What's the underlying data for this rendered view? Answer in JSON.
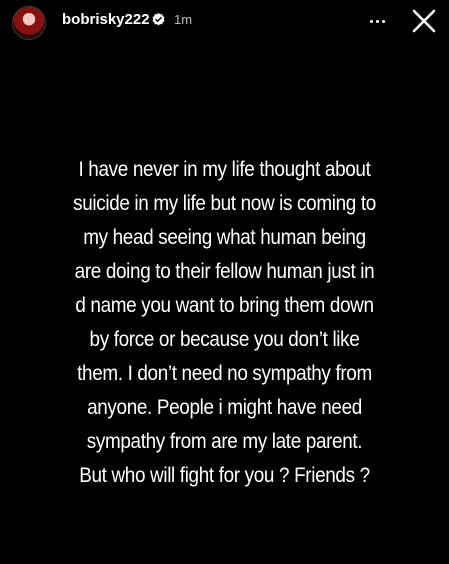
{
  "header": {
    "username": "bobrisky222",
    "time": "1m",
    "avatar_icon": "profile-avatar",
    "verified_icon": "verified-badge-icon",
    "more_icon": "more-horizontal-icon",
    "close_icon": "close-icon"
  },
  "story": {
    "background_color": "#000000",
    "text_color": "#ffffff",
    "lines": [
      "I have never in my life thought about",
      "suicide in my life but now is coming to",
      "my head seeing what human being",
      "are doing to their fellow human just in",
      "d name you want to bring them down",
      "by force or because you don’t like",
      "them. I don’t need no sympathy from",
      "anyone. People i might have need",
      "sympathy from are my late parent.",
      "But who will fight for you ? Friends ?"
    ]
  }
}
